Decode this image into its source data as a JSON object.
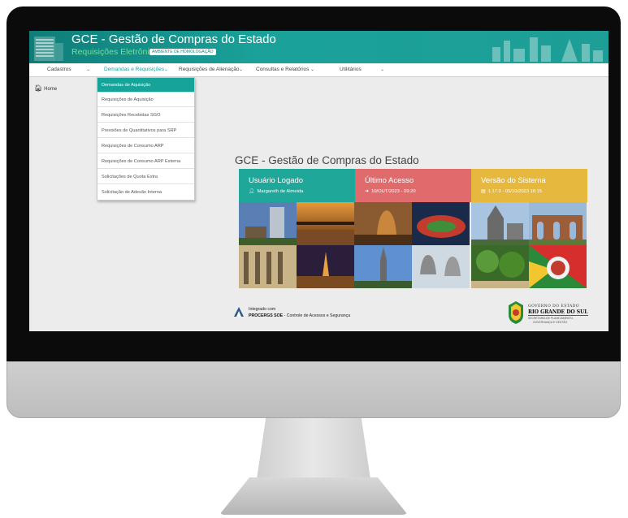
{
  "app": {
    "title": "GCE - Gestão de Compras do Estado",
    "subtitle": "Requisições Eletrônicas",
    "environment_badge": "AMBIENTE DE HOMOLOGAÇÃO"
  },
  "menu": {
    "items": [
      {
        "label": "Cadastros"
      },
      {
        "label": "Demandas e Requisições"
      },
      {
        "label": "Requisições de Alienação"
      },
      {
        "label": "Consultas e Relatórios"
      },
      {
        "label": "Utilitários"
      }
    ]
  },
  "breadcrumb": {
    "home": "Home"
  },
  "dropdown": {
    "items": [
      {
        "label": "Demandas de Aquisição"
      },
      {
        "label": "Requisições de Aquisição"
      },
      {
        "label": "Requisições Recebidas SGO"
      },
      {
        "label": "Previsões de Quantitativos para SRP"
      },
      {
        "label": "Requisições de Consumo ARP"
      },
      {
        "label": "Requisições de Consumo ARP Externa"
      },
      {
        "label": "Solicitações de Quota Extra"
      },
      {
        "label": "Solicitação de Adesão Interna"
      }
    ]
  },
  "main": {
    "title": "GCE - Gestão de Compras do Estado",
    "cards": [
      {
        "title": "Usuário Logado",
        "value": "Margareth de Almeida",
        "color": "#1fa89a",
        "icon": "user-icon"
      },
      {
        "title": "Último Acesso",
        "value": "10/OUT/2023 - 09:20",
        "color": "#e06b6d",
        "icon": "arrow-right-icon"
      },
      {
        "title": "Versão do Sistema",
        "value": "1.17.0 - 05/10/2023 16:15",
        "color": "#e6b83e",
        "icon": "document-icon"
      }
    ]
  },
  "footer": {
    "integrated_with": "Integrado com",
    "procergs_name": "PROCERGS SOE",
    "procergs_desc": " - Controle de Acessos e Segurança",
    "gov_line1": "GOVERNO DO ESTADO",
    "gov_line2": "RIO GRANDE DO SUL",
    "gov_line3": "SECRETARIA DE PLANEJAMENTO,",
    "gov_line4": "GOVERNANÇA E GESTÃO"
  },
  "colors": {
    "accent": "#16a39a",
    "header": "#1aa29a",
    "card_user": "#1fa89a",
    "card_access": "#e06b6d",
    "card_version": "#e6b83e"
  }
}
